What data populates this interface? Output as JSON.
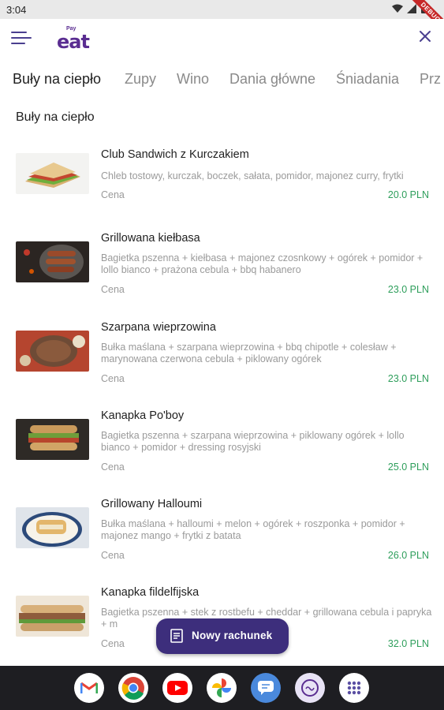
{
  "status_bar": {
    "time": "3:04",
    "debug_label": "DEBUG"
  },
  "app_bar": {
    "logo_tag": "Pay",
    "logo_word": "eat"
  },
  "tabs": [
    {
      "label": "Buły na ciepło",
      "active": true
    },
    {
      "label": "Zupy"
    },
    {
      "label": "Wino"
    },
    {
      "label": "Dania główne"
    },
    {
      "label": "Śniadania"
    },
    {
      "label": "Prz"
    }
  ],
  "section": {
    "title": "Buły na ciepło"
  },
  "items": [
    {
      "name": "Club Sandwich z Kurczakiem",
      "description": "Chleb tostowy, kurczak, boczek, sałata, pomidor, majonez curry, frytki",
      "price_label": "Cena",
      "price": "20.0 PLN"
    },
    {
      "name": "Grillowana kiełbasa",
      "description": "Bagietka pszenna + kiełbasa + majonez czosnkowy + ogórek + pomidor + lollo bianco + prażona cebula + bbq habanero",
      "price_label": "Cena",
      "price": "23.0 PLN"
    },
    {
      "name": "Szarpana wieprzowina",
      "description": "Bułka maślana + szarpana wieprzowina + bbq chipotle + colesław + marynowana czerwona cebula + piklowany ogórek",
      "price_label": "Cena",
      "price": "23.0 PLN"
    },
    {
      "name": "Kanapka Po'boy",
      "description": "Bagietka pszenna + szarpana wieprzowina + piklowany ogórek + lollo bianco + pomidor + dressing rosyjski",
      "price_label": "Cena",
      "price": "25.0 PLN"
    },
    {
      "name": "Grillowany Halloumi",
      "description": "Bułka maślana + halloumi + melon + ogórek + roszponka + pomidor + majonez mango + frytki z batata",
      "price_label": "Cena",
      "price": "26.0 PLN"
    },
    {
      "name": "Kanapka fildelfijska",
      "description": "Bagietka pszenna + stek z rostbefu + cheddar + grillowana cebula i papryka + m",
      "price_label": "Cena",
      "price": "32.0 PLN"
    }
  ],
  "fab": {
    "label": "Nowy rachunek"
  },
  "dock": [
    {
      "icon": "gmail-icon"
    },
    {
      "icon": "chrome-icon"
    },
    {
      "icon": "youtube-icon"
    },
    {
      "icon": "photos-icon"
    },
    {
      "icon": "messages-icon"
    },
    {
      "icon": "payeat-app-icon"
    },
    {
      "icon": "app-drawer-icon"
    }
  ],
  "colors": {
    "brand": "#3d2e7c",
    "price": "#2e9e5b",
    "text_muted": "#9a9a9a"
  }
}
